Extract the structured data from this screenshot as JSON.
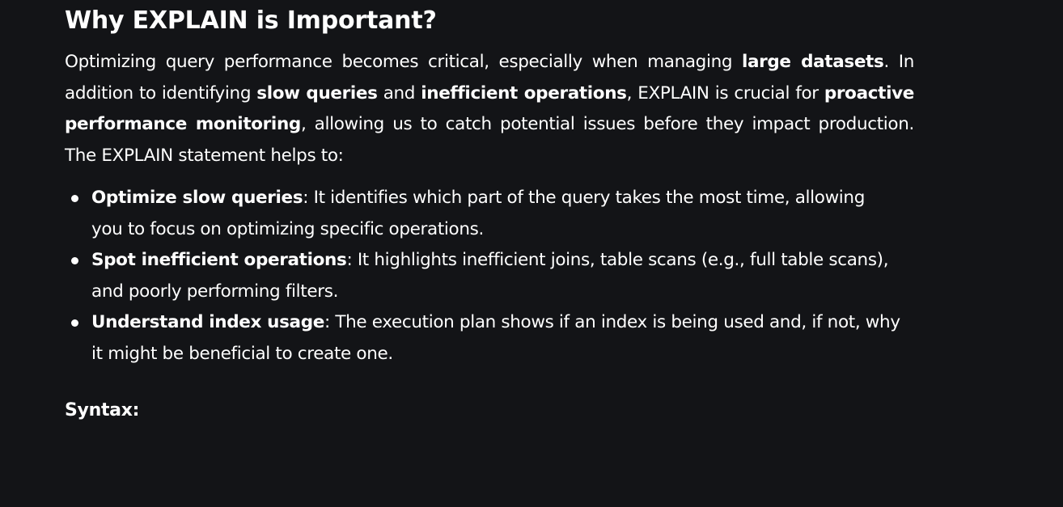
{
  "article": {
    "heading": "Why EXPLAIN is Important?",
    "intro": {
      "t1": "Optimizing query performance becomes critical, especially when managing ",
      "b1": "large datasets",
      "t2": ". In addition to identifying ",
      "b2": "slow queries",
      "t3": " and ",
      "b3": "inefficient operations",
      "t4": ", EXPLAIN is crucial for ",
      "b4": "proactive performance monitoring",
      "t5": ", allowing us to catch potential issues before they impact production. The EXPLAIN statement helps to:"
    },
    "points": [
      {
        "term": "Optimize slow queries",
        "text": ": It identifies which part of the query takes the most time, allowing you to focus on optimizing specific operations."
      },
      {
        "term": "Spot inefficient operations",
        "text": ": It highlights inefficient joins, table scans (e.g., full table scans), and poorly performing filters."
      },
      {
        "term": "Understand index usage",
        "text": ": The execution plan shows if an index is being used and, if not, why it might be beneficial to create one."
      }
    ],
    "syntax_label": "Syntax:"
  }
}
